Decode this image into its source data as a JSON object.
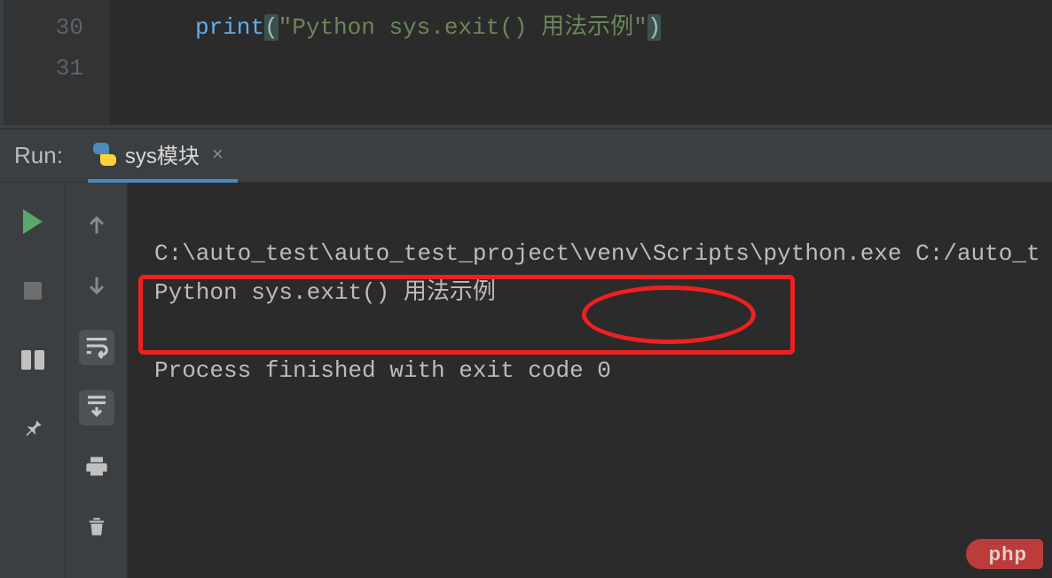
{
  "editor": {
    "lines": {
      "l30": "30",
      "l31": "31"
    },
    "code": {
      "fn": "print",
      "open": "(",
      "q1": "\"",
      "str": "Python sys.exit() 用法示例",
      "q2": "\"",
      "close": ")"
    }
  },
  "run": {
    "label": "Run:",
    "tab_title": "sys模块",
    "tab_close": "×"
  },
  "console": {
    "line1": "C:\\auto_test\\auto_test_project\\venv\\Scripts\\python.exe C:/auto_t",
    "line2": "Python sys.exit() 用法示例",
    "blank": "",
    "line3": "Process finished with exit code 0"
  },
  "icons": {
    "play": "play-icon",
    "stop": "stop-icon",
    "layout": "layout-icon",
    "pin": "pin-icon",
    "up": "arrow-up-icon",
    "down": "arrow-down-icon",
    "wrap": "soft-wrap-icon",
    "scroll": "scroll-to-end-icon",
    "print": "print-icon",
    "trash": "trash-icon",
    "python": "python-icon",
    "close": "close-icon"
  },
  "colors": {
    "bg_editor": "#2b2b2b",
    "bg_panel": "#3c3f41",
    "gutter_text": "#606366",
    "code_fn": "#61afef",
    "code_str": "#6a8759",
    "console_text": "#bcbcbc",
    "highlight": "#f02020",
    "tab_underline": "#4a88c7",
    "play_green": "#59a869"
  },
  "watermark": "php"
}
